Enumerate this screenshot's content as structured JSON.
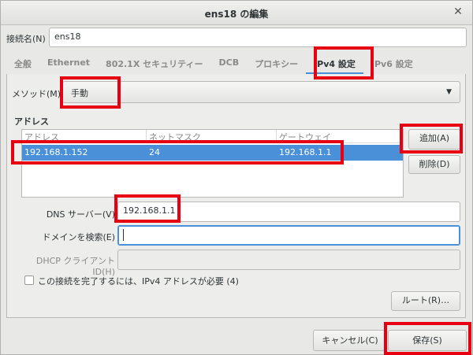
{
  "window": {
    "title": "ens18 の編集"
  },
  "connection_name": {
    "label": "接続名(N)",
    "value": "ens18"
  },
  "tabs": [
    {
      "label": "全般"
    },
    {
      "label": "Ethernet"
    },
    {
      "label": "802.1X セキュリティー"
    },
    {
      "label": "DCB"
    },
    {
      "label": "プロキシー"
    },
    {
      "label": "IPv4 設定",
      "active": true
    },
    {
      "label": "IPv6 設定"
    }
  ],
  "ipv4": {
    "method_label": "メソッド(M)",
    "method_value": "手動",
    "addresses_heading": "アドレス",
    "columns": [
      "アドレス",
      "ネットマスク",
      "ゲートウェイ"
    ],
    "rows": [
      {
        "address": "192.168.1.152",
        "netmask": "24",
        "gateway": "192.168.1.1"
      }
    ],
    "add_button": "追加(A)",
    "delete_button": "削除(D)",
    "dns_label": "DNS サーバー(V)",
    "dns_value": "192.168.1.1",
    "search_domain_label": "ドメインを検索(E)",
    "search_domain_value": "",
    "dhcp_client_id_label": "DHCP クライアント ID(H)",
    "dhcp_client_id_value": "",
    "require_ipv4_label": "この接続を完了するには、IPv4 アドレスが必要 (4)",
    "require_ipv4_checked": false,
    "routes_button": "ルート(R)…"
  },
  "footer": {
    "cancel_button": "キャンセル(C)",
    "save_button": "保存(S)"
  },
  "colors": {
    "highlight": "#e60012",
    "selection": "#4a90d9"
  }
}
